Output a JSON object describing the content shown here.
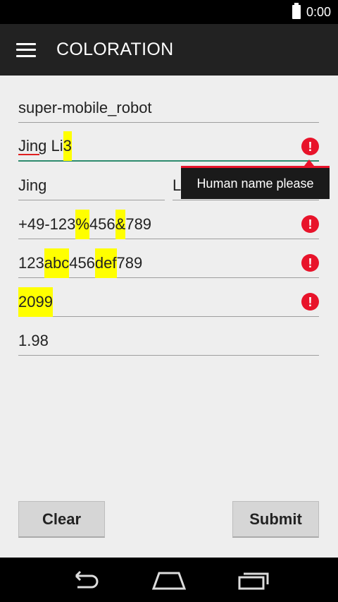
{
  "status_bar": {
    "time": "0:00",
    "battery_icon": "battery-full-icon"
  },
  "action_bar": {
    "title": "COLORATION",
    "menu_icon": "hamburger-menu-icon"
  },
  "fields": {
    "username": {
      "value": "super-mobile_robot"
    },
    "fullname": {
      "value_plain": "Jing",
      "value_rest": " Li",
      "value_hl": "3",
      "error": true
    },
    "firstname": {
      "value": "Jing"
    },
    "lastname": {
      "value_visible": "Li"
    },
    "phone": {
      "parts": [
        "+49-123",
        "%",
        "456",
        "&",
        "789"
      ],
      "error": true
    },
    "code": {
      "parts": [
        "123",
        "abc",
        "456",
        "def",
        "789"
      ],
      "error": true
    },
    "year": {
      "value_hl": "2099",
      "error": true
    },
    "height": {
      "value": "1.98"
    }
  },
  "tooltip": {
    "text": "Human name please"
  },
  "buttons": {
    "clear_label": "Clear",
    "submit_label": "Submit"
  },
  "colors": {
    "accent": "#2e8b6e",
    "error": "#e8132a",
    "highlight": "#ffff00",
    "action_bar": "#222222"
  },
  "nav_bar": {
    "icons": [
      "back-icon",
      "home-icon",
      "recent-apps-icon"
    ]
  }
}
